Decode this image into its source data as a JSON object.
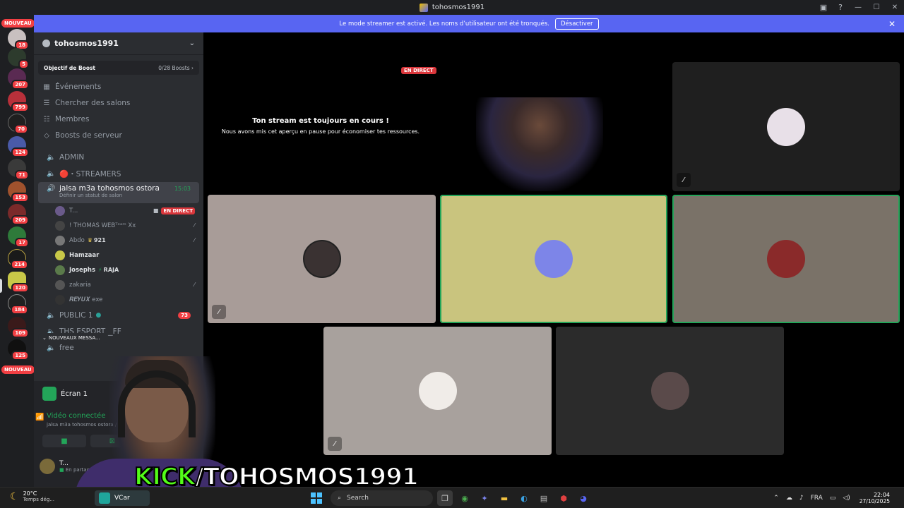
{
  "window": {
    "title": "tohosmos1991"
  },
  "banner": {
    "text": "Le mode streamer est activé. Les noms d’utilisateur ont été tronqués.",
    "button": "Désactiver"
  },
  "servers": {
    "new_label": "NOUVEAU",
    "badges": [
      "18",
      "5",
      "207",
      "799",
      "70",
      "124",
      "71",
      "153",
      "209",
      "17",
      "214",
      "120",
      "184",
      "109",
      "125"
    ]
  },
  "guild": {
    "name": "tohosmos1991",
    "boost_goal": "Objectif de Boost",
    "boost_count": "0/28 Boosts"
  },
  "menu": [
    {
      "label": "Événements",
      "icon": "calendar-icon"
    },
    {
      "label": "Chercher des salons",
      "icon": "search-channels-icon"
    },
    {
      "label": "Membres",
      "icon": "members-icon"
    },
    {
      "label": "Boosts de serveur",
      "icon": "boost-icon"
    }
  ],
  "channels": {
    "admin": "ADMIN",
    "streamers": "🔴・STREAMERS",
    "active": {
      "name": "jalsa m3a tohosmos ostora",
      "time": "15:03",
      "status_hint": "Définir un statut de salon"
    },
    "public1": "PUBLIC 1",
    "public1_badge": "73",
    "ths": "THS ESPORT__FF",
    "free": "free",
    "new_messages": "NOUVEAUX MESSA..."
  },
  "voice_users": [
    {
      "name": "T...",
      "live": "EN DIRECT"
    },
    {
      "name": "! THOMAS WEBᵀᵉᵃᵐ Xx"
    },
    {
      "name": "Abdo",
      "tag": "921"
    },
    {
      "name": "Hamzaar"
    },
    {
      "name": "Josephs",
      "tag": "RAJA"
    },
    {
      "name": "zakaria"
    },
    {
      "name": "𝑹𝑬𝒀𝑼𝑿 exe"
    }
  ],
  "screen_panel": {
    "title": "Écran 1",
    "rtc_status": "Vidéo connectée",
    "rtc_channel": "jalsa m3a tohosmos ostora / tohos",
    "user_name": "T...",
    "user_status": "En partage d'écran"
  },
  "stream": {
    "live": "EN DIRECT",
    "paused_title": "Ton stream est toujours en cours !",
    "paused_sub": "Nous avons mis cet aperçu en pause pour économiser tes ressources."
  },
  "overlay": {
    "kick": "KICK",
    "handle": "/TOHOSMOS1991"
  },
  "taskbar": {
    "temp": "20°C",
    "weather": "Temps dég...",
    "search": "Search",
    "vcard": "VCar",
    "lang": "FRA",
    "time": "22:04",
    "date": "27/10/2025"
  },
  "colors": {
    "brand": "#5865f2",
    "live": "#da373c",
    "connected": "#23a559",
    "kick_green": "#53fc18"
  }
}
